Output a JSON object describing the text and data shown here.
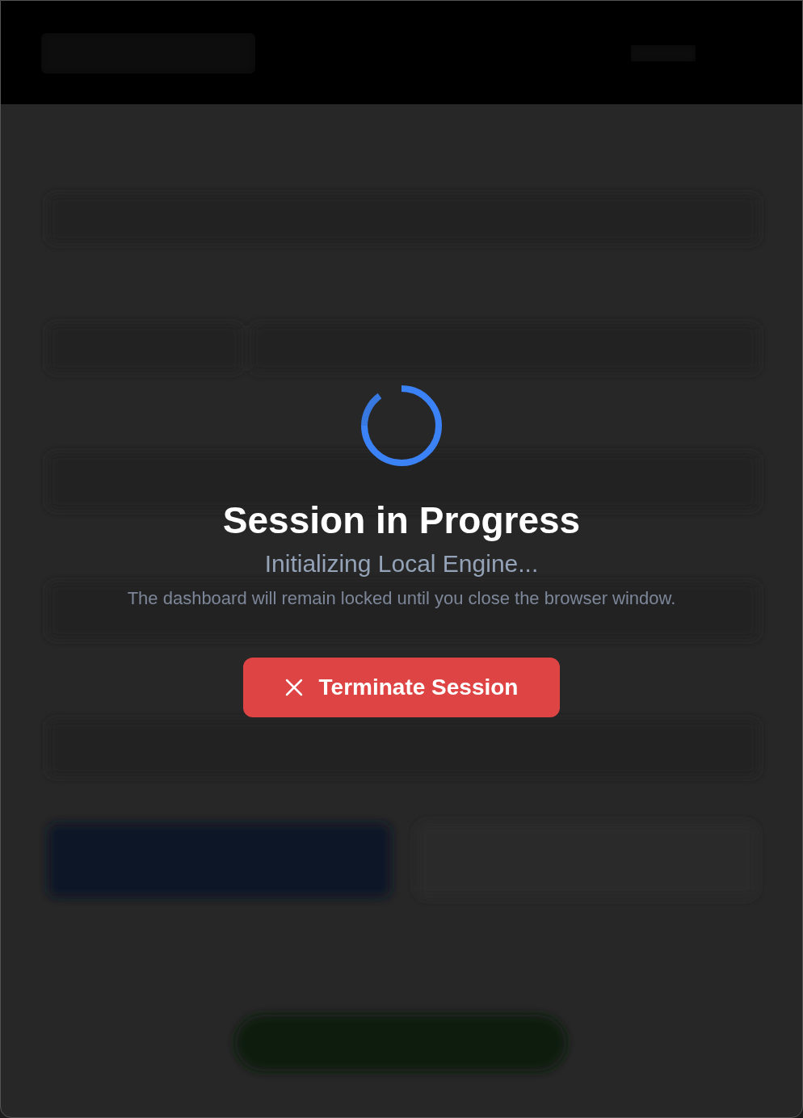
{
  "overlay": {
    "title": "Session in Progress",
    "status": "Initializing Local Engine...",
    "message": "The dashboard will remain locked until you close the browser window.",
    "button": {
      "label": "Terminate Session"
    }
  }
}
